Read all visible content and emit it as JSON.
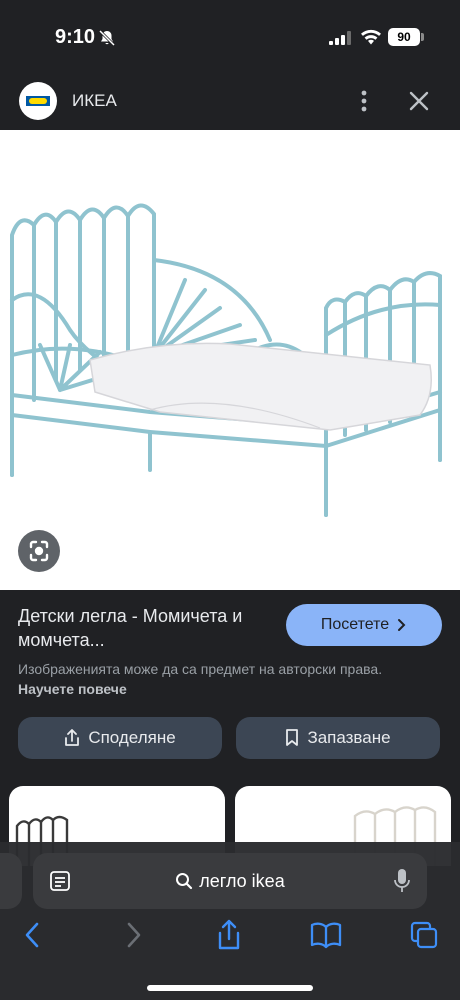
{
  "status_bar": {
    "time": "9:10",
    "battery": "90"
  },
  "site": {
    "name": "ИКЕА"
  },
  "result": {
    "title": "Детски легла - Момичета и момчета...",
    "visit_label": "Посетете",
    "copyright_text": "Изображенията може да са предмет на авторски права.",
    "learn_more": "Научете повече"
  },
  "actions": {
    "share_label": "Споделяне",
    "save_label": "Запазване"
  },
  "toolbar": {
    "address_text": "легло ikea"
  },
  "colors": {
    "background": "#202124",
    "accent": "#8ab4f8",
    "action_button": "#3c4654",
    "bed_frame": "#8fc3cf"
  },
  "icons": [
    "bell-off-icon",
    "signal-icon",
    "wifi-icon",
    "more-vert-icon",
    "close-icon",
    "lens-icon",
    "share-icon",
    "bookmark-icon",
    "page-menu-icon",
    "search-icon",
    "mic-icon",
    "back-icon",
    "forward-icon",
    "share-sheet-icon",
    "bookmarks-icon",
    "tabs-icon"
  ]
}
